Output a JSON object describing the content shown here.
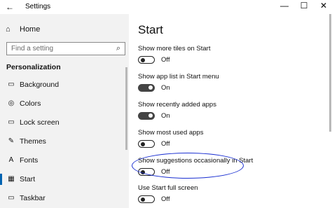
{
  "window": {
    "title": "Settings",
    "back_icon": "←",
    "minimize": "—",
    "maximize": "☐",
    "close": "✕"
  },
  "sidebar": {
    "home_icon": "⌂",
    "home_label": "Home",
    "search_placeholder": "Find a setting",
    "search_icon": "⌕",
    "section_title": "Personalization",
    "items": [
      {
        "label": "Background",
        "icon": "▭"
      },
      {
        "label": "Colors",
        "icon": "◎"
      },
      {
        "label": "Lock screen",
        "icon": "▭"
      },
      {
        "label": "Themes",
        "icon": "✎"
      },
      {
        "label": "Fonts",
        "icon": "A"
      },
      {
        "label": "Start",
        "icon": "▦",
        "selected": true
      },
      {
        "label": "Taskbar",
        "icon": "▭"
      }
    ]
  },
  "main": {
    "heading": "Start",
    "settings": [
      {
        "label": "Show more tiles on Start",
        "state": "Off",
        "on": false
      },
      {
        "label": "Show app list in Start menu",
        "state": "On",
        "on": true
      },
      {
        "label": "Show recently added apps",
        "state": "On",
        "on": true
      },
      {
        "label": "Show most used apps",
        "state": "Off",
        "on": false
      },
      {
        "label": "Show suggestions occasionally in Start",
        "state": "Off",
        "on": false
      },
      {
        "label": "Use Start full screen",
        "state": "Off",
        "on": false
      }
    ]
  },
  "colors": {
    "accent": "#0063b1",
    "annotation": "#1a2fd1"
  }
}
